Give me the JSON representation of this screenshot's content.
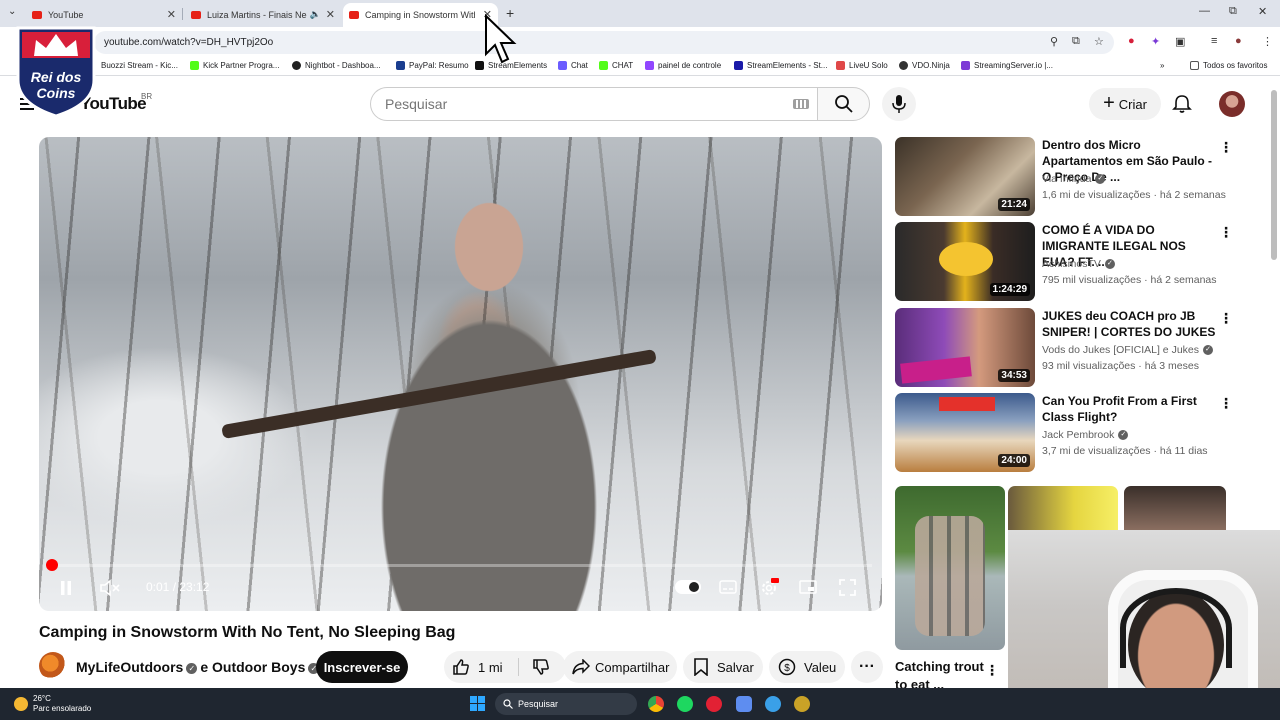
{
  "browser": {
    "tabs": [
      {
        "title": "YouTube",
        "active": false
      },
      {
        "title": "Luiza Martins - Finais Neces",
        "active": false
      },
      {
        "title": "Camping in Snowstorm With N",
        "active": true
      }
    ],
    "url": "youtube.com/watch?v=DH_HVTpj2Oo",
    "bookmarks": [
      "Buozzi Stream - Kic...",
      "Kick Partner Progra...",
      "Nightbot - Dashboa...",
      "PayPal: Resumo",
      "StreamElements",
      "Chat",
      "CHAT",
      "painel de controle",
      "StreamElements - St...",
      "LiveU Solo",
      "VDO.Ninja",
      "StreamingServer.io |..."
    ],
    "all_bookmarks": "Todos os favoritos"
  },
  "overlay_logo": {
    "line1": "Rei dos",
    "line2": "Coins"
  },
  "youtube": {
    "logo_text": "YouTube",
    "region": "BR",
    "search_placeholder": "Pesquisar",
    "create_label": "Criar"
  },
  "player": {
    "time": "0:01 / 23:12",
    "progress": 0.001
  },
  "video": {
    "title": "Camping in Snowstorm With No Tent, No Sleeping Bag",
    "channel": "MyLifeOutdoors",
    "channel_join": "e",
    "channel2": "Outdoor Boys",
    "subscribe_label": "Inscrever-se",
    "likes": "1 mi",
    "share_label": "Compartilhar",
    "save_label": "Salvar",
    "thanks_label": "Valeu"
  },
  "recommendations": [
    {
      "title": "Dentro dos Micro Apartamentos em São Paulo - O Preço De ...",
      "channel": "Via Infinda",
      "meta": "1,6 mi de visualizações · há 2 semanas",
      "duration": "21:24",
      "thumb_color": "#6b5a45"
    },
    {
      "title": "COMO É A VIDA DO IMIGRANTE ILEGAL NOS EUA? FT. ...",
      "channel": "AchismosTV",
      "meta": "795 mil visualizações · há 2 semanas",
      "duration": "1:24:29",
      "thumb_color": "#d4a21a"
    },
    {
      "title": "JUKES deu COACH pro JB SNIPER! | CORTES DO JUKES",
      "channel": "Vods do Jukes [OFICIAL] e Jukes",
      "meta": "93 mil visualizações · há 3 meses",
      "duration": "34:53",
      "thumb_color": "#7b3fa0"
    },
    {
      "title": "Can You Profit From a First Class Flight?",
      "channel": "Jack Pembrook",
      "meta": "3,7 mi de visualizações · há 11 dias",
      "duration": "24:00",
      "thumb_color": "#2b4f8a"
    }
  ],
  "shorts": {
    "first_title": "Catching trout to eat ..."
  },
  "taskbar": {
    "temp": "26°C",
    "weather": "Parc ensolarado",
    "search_placeholder": "Pesquisar"
  }
}
